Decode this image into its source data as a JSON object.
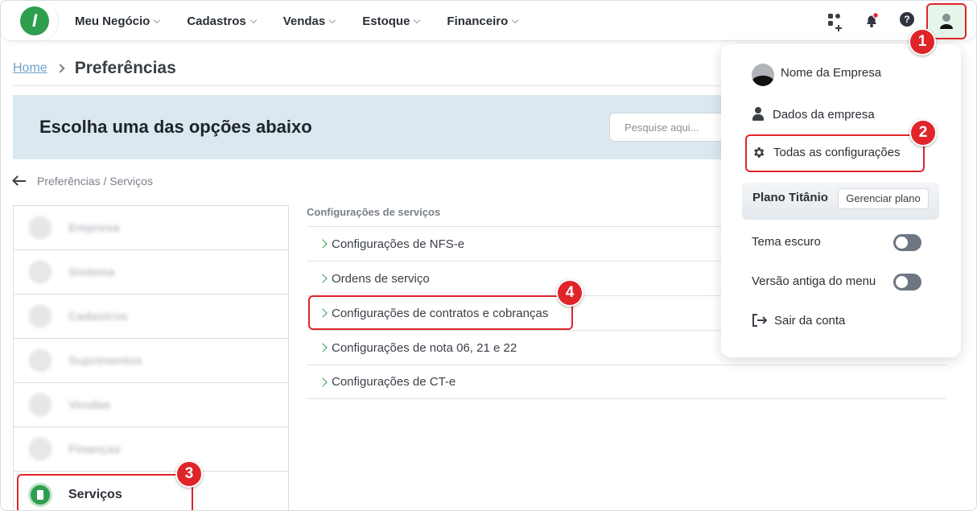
{
  "nav": {
    "logo": "I",
    "items": [
      "Meu Negócio",
      "Cadastros",
      "Vendas",
      "Estoque",
      "Financeiro"
    ],
    "notification_dot_color": "#e0242a"
  },
  "breadcrumb": {
    "home": "Home",
    "current": "Preferências"
  },
  "banner": {
    "title": "Escolha uma das opções abaixo",
    "search_placeholder": "Pesquise aqui..."
  },
  "back": {
    "label": "Preferências / Serviços"
  },
  "left_menu": {
    "items": [
      "Empresa",
      "Sistema",
      "Cadastros",
      "Suprimentos",
      "Vendas",
      "Finanças"
    ],
    "active": "Serviços"
  },
  "services": {
    "title": "Configurações de serviços",
    "items": [
      "Configurações de NFS-e",
      "Ordens de serviço",
      "Configurações de contratos e cobranças",
      "Configurações de nota 06, 21 e 22",
      "Configurações de CT-e"
    ]
  },
  "dropdown": {
    "company_name": "Nome da Empresa",
    "company_data": "Dados da empresa",
    "all_settings": "Todas as configurações",
    "plan_label": "Plano Titânio",
    "plan_button": "Gerenciar plano",
    "dark_theme": "Tema escuro",
    "old_menu": "Versão antiga do menu",
    "logout": "Sair da conta"
  },
  "steps": [
    "1",
    "2",
    "3",
    "4"
  ],
  "colors": {
    "accent": "#2e9e4f",
    "highlight": "#e0242a",
    "banner": "#dbe8ef"
  }
}
